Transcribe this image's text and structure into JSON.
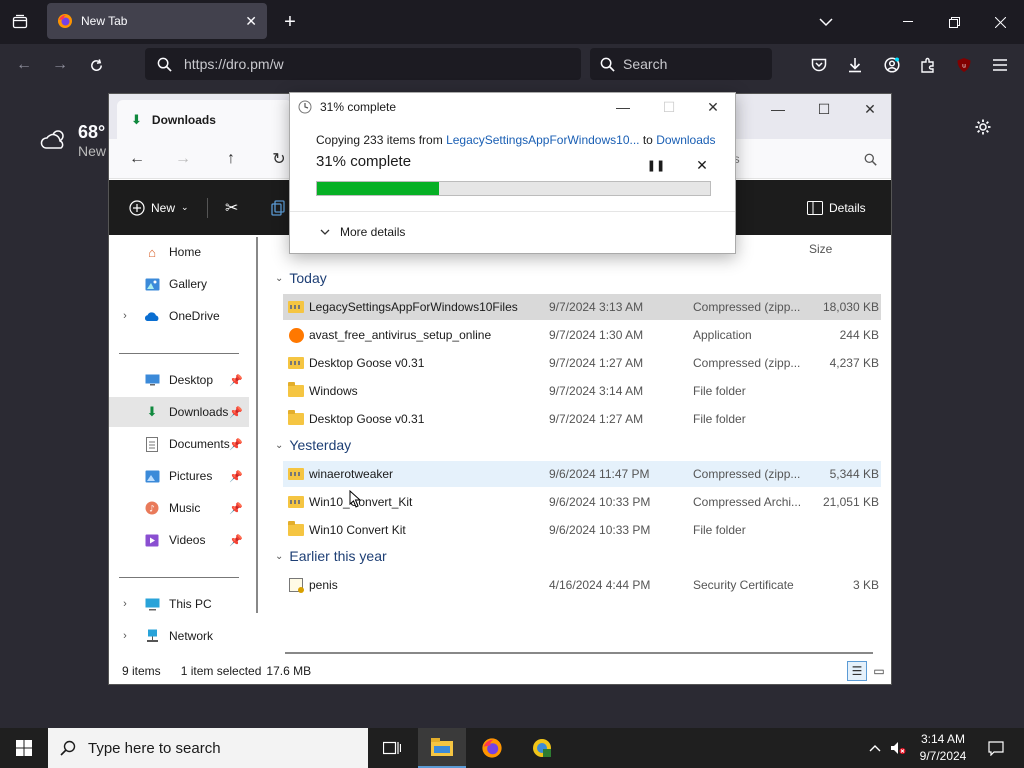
{
  "browser": {
    "tab_title": "New Tab",
    "url": "https://dro.pm/w",
    "search_placeholder": "Search"
  },
  "newtab": {
    "weather_temp": "68°",
    "weather_loc": "New"
  },
  "explorer": {
    "tab_title": "Downloads",
    "search_hint": "ds",
    "cmd_new": "New",
    "cmd_details": "Details",
    "col_size": "Size",
    "sidebar": [
      {
        "label": "Home"
      },
      {
        "label": "Gallery"
      },
      {
        "label": "OneDrive"
      },
      {
        "label": "Desktop"
      },
      {
        "label": "Downloads"
      },
      {
        "label": "Documents"
      },
      {
        "label": "Pictures"
      },
      {
        "label": "Music"
      },
      {
        "label": "Videos"
      },
      {
        "label": "This PC"
      },
      {
        "label": "Network"
      }
    ],
    "groups": [
      "Today",
      "Yesterday",
      "Earlier this year"
    ],
    "files": [
      {
        "name": "LegacySettingsAppForWindows10Files",
        "date": "9/7/2024 3:13 AM",
        "type": "Compressed (zipp...",
        "size": "18,030 KB"
      },
      {
        "name": "avast_free_antivirus_setup_online",
        "date": "9/7/2024 1:30 AM",
        "type": "Application",
        "size": "244 KB"
      },
      {
        "name": "Desktop Goose v0.31",
        "date": "9/7/2024 1:27 AM",
        "type": "Compressed (zipp...",
        "size": "4,237 KB"
      },
      {
        "name": "Windows",
        "date": "9/7/2024 3:14 AM",
        "type": "File folder",
        "size": ""
      },
      {
        "name": "Desktop Goose v0.31",
        "date": "9/7/2024 1:27 AM",
        "type": "File folder",
        "size": ""
      },
      {
        "name": "winaerotweaker",
        "date": "9/6/2024 11:47 PM",
        "type": "Compressed (zipp...",
        "size": "5,344 KB"
      },
      {
        "name": "Win10_Convert_Kit",
        "date": "9/6/2024 10:33 PM",
        "type": "Compressed Archi...",
        "size": "21,051 KB"
      },
      {
        "name": "Win10 Convert Kit",
        "date": "9/6/2024 10:33 PM",
        "type": "File folder",
        "size": ""
      },
      {
        "name": "penis",
        "date": "4/16/2024 4:44 PM",
        "type": "Security Certificate",
        "size": "3 KB"
      }
    ],
    "status_items": "9 items",
    "status_selected": "1 item selected",
    "status_size": "17.6 MB"
  },
  "copy_dialog": {
    "title": "31% complete",
    "line_prefix": "Copying 233 items from ",
    "source": "LegacySettingsAppForWindows10...",
    "line_mid": " to ",
    "dest": "Downloads",
    "percent_text": "31% complete",
    "progress": 0.31,
    "more_details": "More details"
  },
  "taskbar": {
    "search_placeholder": "Type here to search",
    "time": "3:14 AM",
    "date": "9/7/2024"
  },
  "colors": {
    "progress_green": "#06b025",
    "link_blue": "#1a5fb4",
    "group_header": "#1e3f75"
  }
}
